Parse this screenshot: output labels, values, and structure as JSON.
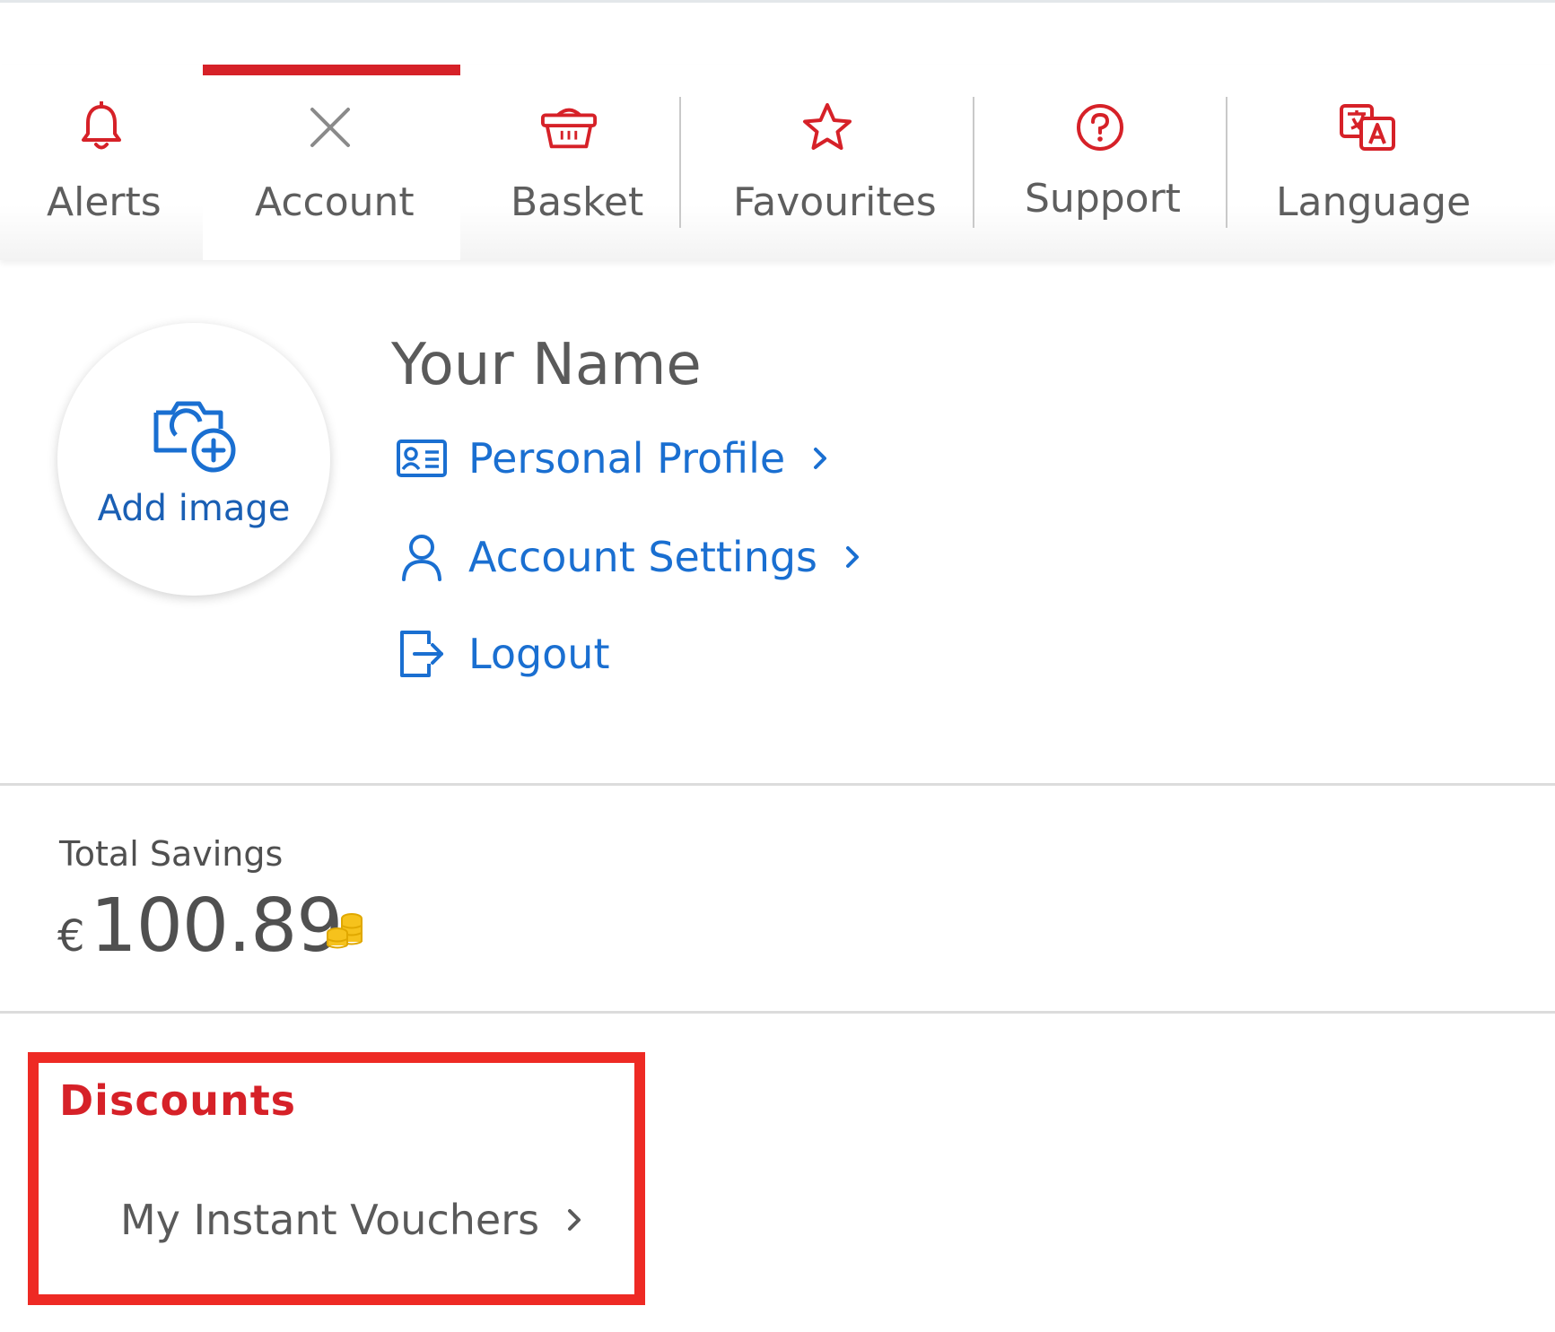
{
  "nav": {
    "items": [
      {
        "label": "Alerts",
        "icon": "bell-icon"
      },
      {
        "label": "Account",
        "icon": "close-icon",
        "active": true
      },
      {
        "label": "Basket",
        "icon": "basket-icon"
      },
      {
        "label": "Favourites",
        "icon": "star-icon"
      },
      {
        "label": "Support",
        "icon": "help-circle-icon"
      },
      {
        "label": "Language",
        "icon": "translate-icon"
      }
    ],
    "accent_color": "#d62128"
  },
  "profile": {
    "add_image_label": "Add image",
    "name": "Your Name",
    "links": [
      {
        "label": "Personal Profile",
        "icon": "id-card-icon",
        "has_chevron": true
      },
      {
        "label": "Account Settings",
        "icon": "user-icon",
        "has_chevron": true
      },
      {
        "label": "Logout",
        "icon": "logout-icon",
        "has_chevron": false
      }
    ],
    "link_color": "#1a6fd1"
  },
  "savings": {
    "label": "Total Savings",
    "currency": "€",
    "amount": "100.89",
    "icon": "coins-icon"
  },
  "discounts": {
    "title": "Discounts",
    "items": [
      {
        "label": "My Instant Vouchers"
      }
    ],
    "highlight_color": "#ee2a24"
  }
}
